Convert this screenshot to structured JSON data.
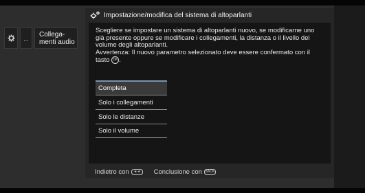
{
  "sidebar": {
    "gear_icon": "gear-icon",
    "dots_label": "...",
    "current_label": "Collega-\nmenti audio"
  },
  "panel": {
    "title": "Impostazione/modifica del sistema di altoparlanti",
    "description_1": "Scegliere se impostare un sistema di altoparlanti nuovo, se modificarne uno già presente oppure se modificare i collegamenti, la distanza o il livello del volume degli altoparlanti.",
    "description_2": "Avvertenza: Il nuovo parametro selezionato deve essere confermato con il tasto",
    "ok_key": "OK",
    "description_end": ".",
    "options": [
      {
        "label": "Completa"
      },
      {
        "label": "Solo i collegamenti"
      },
      {
        "label": "Solo le distanze"
      },
      {
        "label": "Solo il volume"
      }
    ]
  },
  "footer": {
    "back_label": "Indietro con",
    "back_key": "◄◄",
    "finish_label": "Conclusione con",
    "finish_key": "BACK"
  }
}
